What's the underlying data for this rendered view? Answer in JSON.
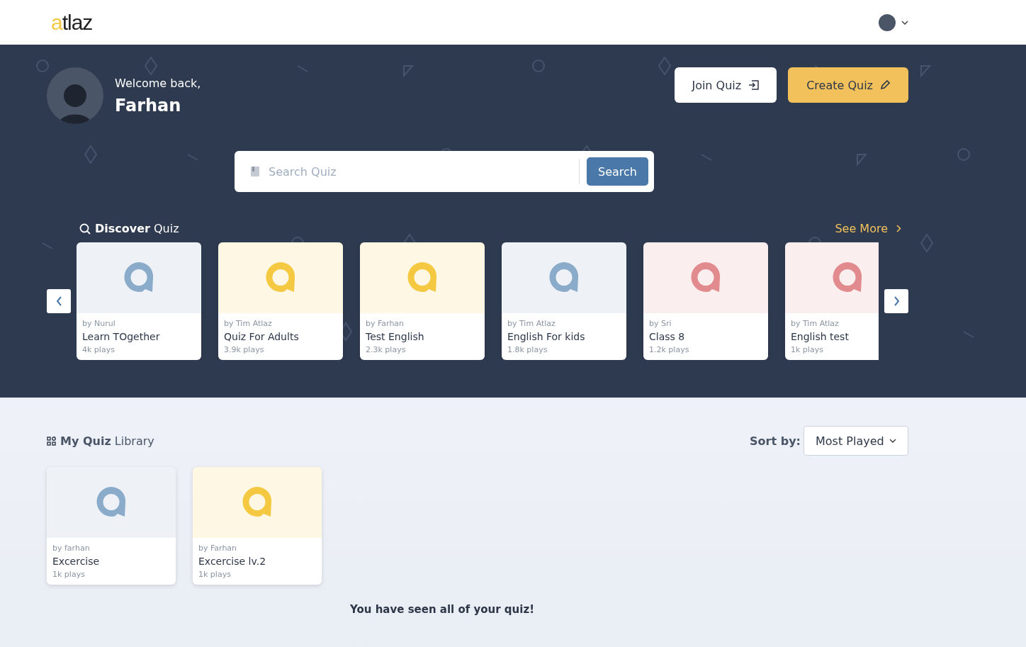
{
  "header": {
    "logo_accent": "a",
    "logo_rest": "tlaz"
  },
  "hero": {
    "greeting": "Welcome back,",
    "user_name": "Farhan",
    "join_button": "Join Quiz",
    "create_button": "Create Quiz"
  },
  "search": {
    "placeholder": "Search Quiz",
    "button": "Search"
  },
  "discover": {
    "title": "**Discover** Quiz",
    "see_more": "See More",
    "quizzes": [
      {
        "author": "by Nurul",
        "title": "Learn TOgether",
        "plays": "4k plays",
        "color": "#8aabc9"
      },
      {
        "author": "by Tim Atlaz",
        "title": "Quiz For Adults",
        "plays": "3.9k plays",
        "color": "#f5c842"
      },
      {
        "author": "by Farhan",
        "title": "Test English",
        "plays": "2.3k plays",
        "color": "#f5c842"
      },
      {
        "author": "by Tim Atlaz",
        "title": "English For kids",
        "plays": "1.8k plays",
        "color": "#8aabc9"
      },
      {
        "author": "by Sri",
        "title": "Class 8",
        "plays": "1.2k plays",
        "color": "#e28b8f"
      },
      {
        "author": "by Tim Atlaz",
        "title": "English test",
        "plays": "1k plays",
        "color": "#e28b8f"
      }
    ]
  },
  "library": {
    "title": "**My Quiz** Library",
    "sort_label": "Sort by:",
    "sort_value": "Most Played",
    "quizzes": [
      {
        "author": "by farhan",
        "title": "Excercise",
        "plays": "1k plays",
        "color": "#8aabc9"
      },
      {
        "author": "by Farhan",
        "title": "Excercise lv.2",
        "plays": "1k plays",
        "color": "#f5c842"
      }
    ],
    "end_message": "You have seen all of your quiz!"
  }
}
